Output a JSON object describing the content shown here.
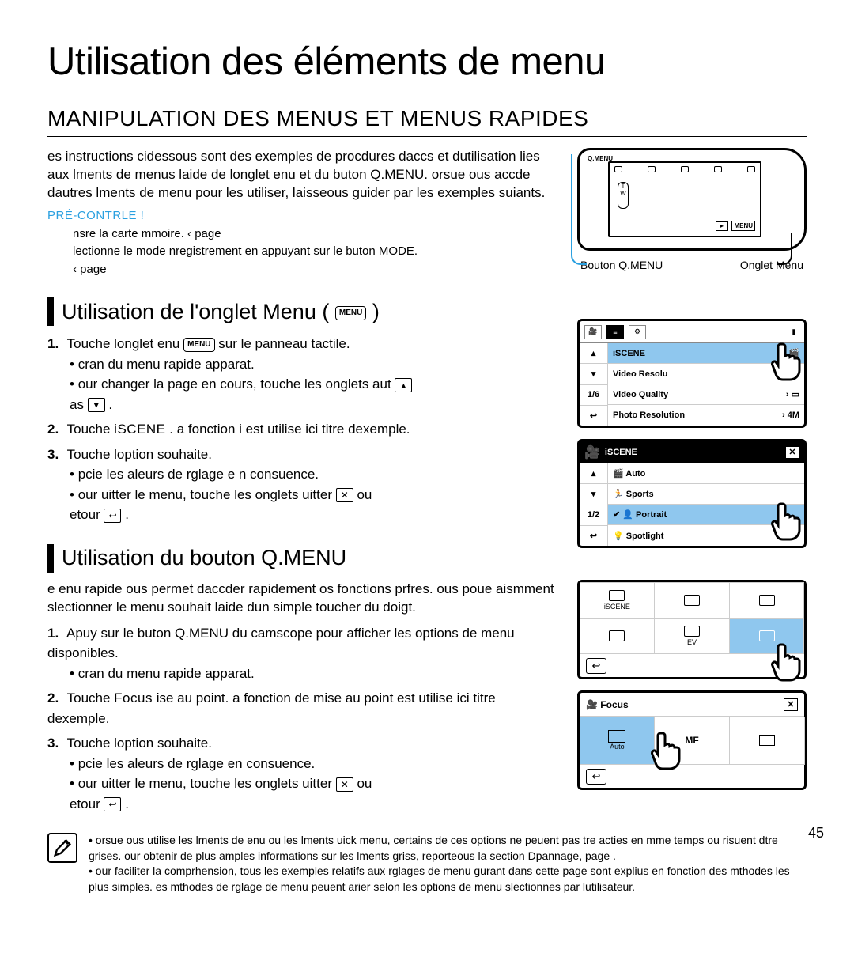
{
  "title": "Utilisation des éléments de menu",
  "section_title": "MANIPULATION DES MENUS ET MENUS RAPIDES",
  "intro": "es instructions cidessous sont des exemples de procdures daccs et dutilisation lies aux lments de menus laide de longlet enu et du buton Q.MENU. orsue ous accde dautres lments de menu pour les utiliser, laisseous guider par les exemples suiants.",
  "precontrol_label": "PRÉ-CONTRLE !",
  "precontrol_items": {
    "a": "nsre la carte mmoire.         ‹ page",
    "b": "lectionne le mode nregistrement en appuyant sur le buton MODE.",
    "c": "‹ page"
  },
  "camera_labels": {
    "qmenu": "Bouton Q.MENU",
    "menu": "Onglet Menu"
  },
  "subsection_menu": {
    "title": "Utilisation de l'onglet Menu (",
    "badge": "MENU",
    "title_close": ")",
    "step1_a": "Touche longlet enu",
    "step1_badge": "MENU",
    "step1_b": "sur le panneau tactile.",
    "step1_sub1": "cran du menu rapide apparat.",
    "step1_sub2a": "our changer la page en cours, touche les onglets aut",
    "step1_sub2b": "as",
    "step2_a": "Touche",
    "step2_mono": "iSCENE",
    "step2_b": ". a fonction",
    "step2_c": "i est utilise ici  titre dexemple.",
    "step3": "Touche loption souhaite.",
    "step3_sub1": "pcie les aleurs de rglage e n consuence.",
    "step3_sub2a": "our uitter le menu, touche les onglets uitter",
    "step3_sub2b": "ou",
    "step3_sub2c": "etour"
  },
  "subsection_qmenu": {
    "title": "Utilisation du bouton Q.MENU",
    "intro": "e enu rapide ous permet daccder rapidement os fonctions prfres. ous poue aismment slectionner le menu souhait laide dun simple toucher du doigt.",
    "step1_a": "Apuy sur le buton Q.MENU du camscope pour afficher les options de menu disponibles.",
    "step1_sub": "cran du menu rapide apparat.",
    "step2_a": "Touche",
    "step2_mono": "Focus",
    "step2_b": "ise au point. a fonction de mise au point est utilise ici  titre dexemple.",
    "step3": "Touche loption souhaite.",
    "step3_sub1": "pcie les aleurs de rglage en consuence.",
    "step3_sub2a": "our uitter le menu, touche les onglets uitter",
    "step3_sub2b": "ou",
    "step3_sub2c": "etour"
  },
  "panel1": {
    "rows": {
      "r1": "iSCENE",
      "r2": "Video Resolu",
      "r3": "Video Quality",
      "r4": "Photo Resolution"
    },
    "left": {
      "up": "▴",
      "down": "▾",
      "page": "1/6",
      "back": "↩"
    }
  },
  "panel2": {
    "header_title": "iSCENE",
    "rows": {
      "r1": "Auto",
      "r2": "Sports",
      "r3": "Portrait",
      "r4": "Spotlight"
    },
    "left": {
      "up": "▴",
      "down": "▾",
      "page": "1/2",
      "back": "↩"
    }
  },
  "qgrid": {
    "cells": {
      "c1": "iSCENE",
      "c5": "EV"
    },
    "back": "↩"
  },
  "focus": {
    "title": "Focus",
    "cells": {
      "c1": "Auto",
      "c2": "MF",
      "c3": ""
    },
    "back": "↩"
  },
  "note": {
    "a": "orsue ous utilise les lments de enu ou les lments uick menu, certains de ces options ne peuent pas tre acties en mme temps ou risuent dtre grises. our obtenir de plus amples informations sur les lments griss, reporteous la section Dpannage, page .",
    "b": "our faciliter la comprhension, tous les exemples relatifs aux rglages de menu gurant dans cette page sont explius en fonction des mthodes les plus simples. es mthodes de rglage de menu peuent arier selon les options de menu slectionnes par lutilisateur."
  },
  "page_number": "45"
}
